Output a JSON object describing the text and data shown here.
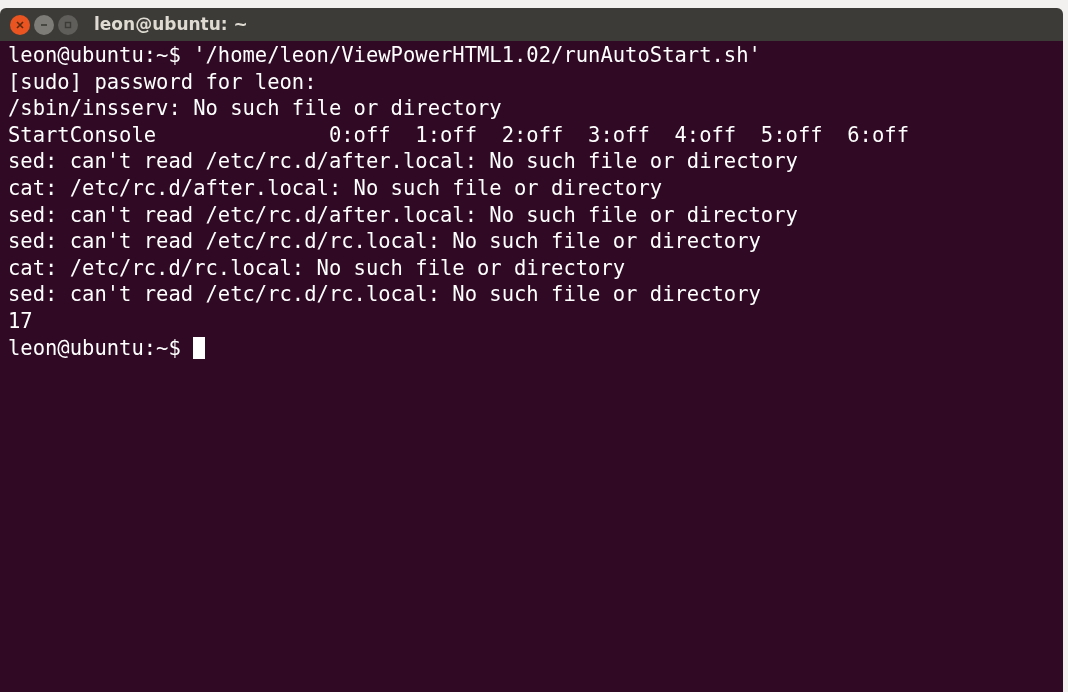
{
  "window": {
    "title": "leon@ubuntu: ~"
  },
  "terminal": {
    "lines": [
      "leon@ubuntu:~$ '/home/leon/ViewPowerHTML1.02/runAutoStart.sh'",
      "[sudo] password for leon:",
      "/sbin/insserv: No such file or directory",
      "StartConsole              0:off  1:off  2:off  3:off  4:off  5:off  6:off",
      "sed: can't read /etc/rc.d/after.local: No such file or directory",
      "cat: /etc/rc.d/after.local: No such file or directory",
      "sed: can't read /etc/rc.d/after.local: No such file or directory",
      "sed: can't read /etc/rc.d/rc.local: No such file or directory",
      "cat: /etc/rc.d/rc.local: No such file or directory",
      "sed: can't read /etc/rc.d/rc.local: No such file or directory",
      "17"
    ],
    "prompt": "leon@ubuntu:~$"
  }
}
